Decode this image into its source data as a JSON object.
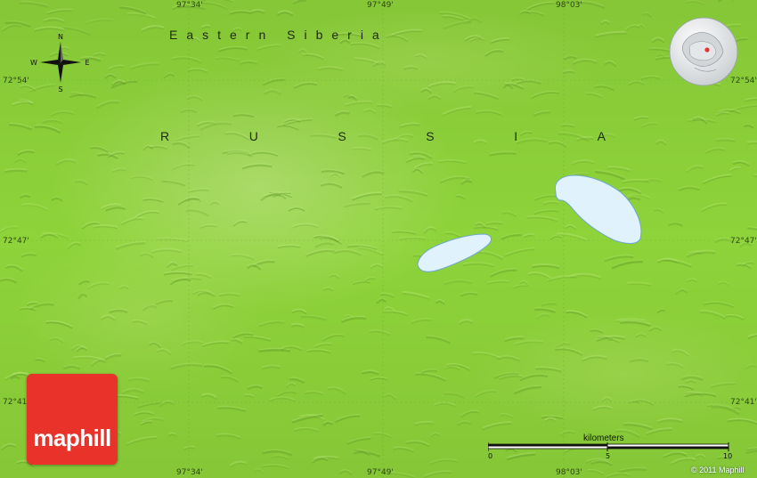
{
  "labels": {
    "region": "Eastern Siberia",
    "country_letters": [
      "R",
      "U",
      "S",
      "S",
      "I",
      "A"
    ]
  },
  "coordinates": {
    "top": [
      "97°34'",
      "97°49'",
      "98°03'"
    ],
    "bottom": [
      "97°34'",
      "97°49'",
      "98°03'"
    ],
    "left": [
      "72°54'",
      "72°47'",
      "72°41'"
    ],
    "right": [
      "72°54'",
      "72°47'",
      "72°41'"
    ]
  },
  "compass": {
    "n": "N",
    "s": "S",
    "e": "E",
    "w": "W"
  },
  "scale": {
    "title": "kilometers",
    "ticks": [
      "0",
      "5",
      "10"
    ]
  },
  "logo": {
    "text": "maphill"
  },
  "copyright": "© 2011 Maphill",
  "colors": {
    "land": "#8ed33a",
    "water": "#e0f2fb",
    "logo": "#e8322a"
  },
  "icons": {
    "compass": "compass-rose-icon",
    "globe": "locator-globe-icon"
  }
}
